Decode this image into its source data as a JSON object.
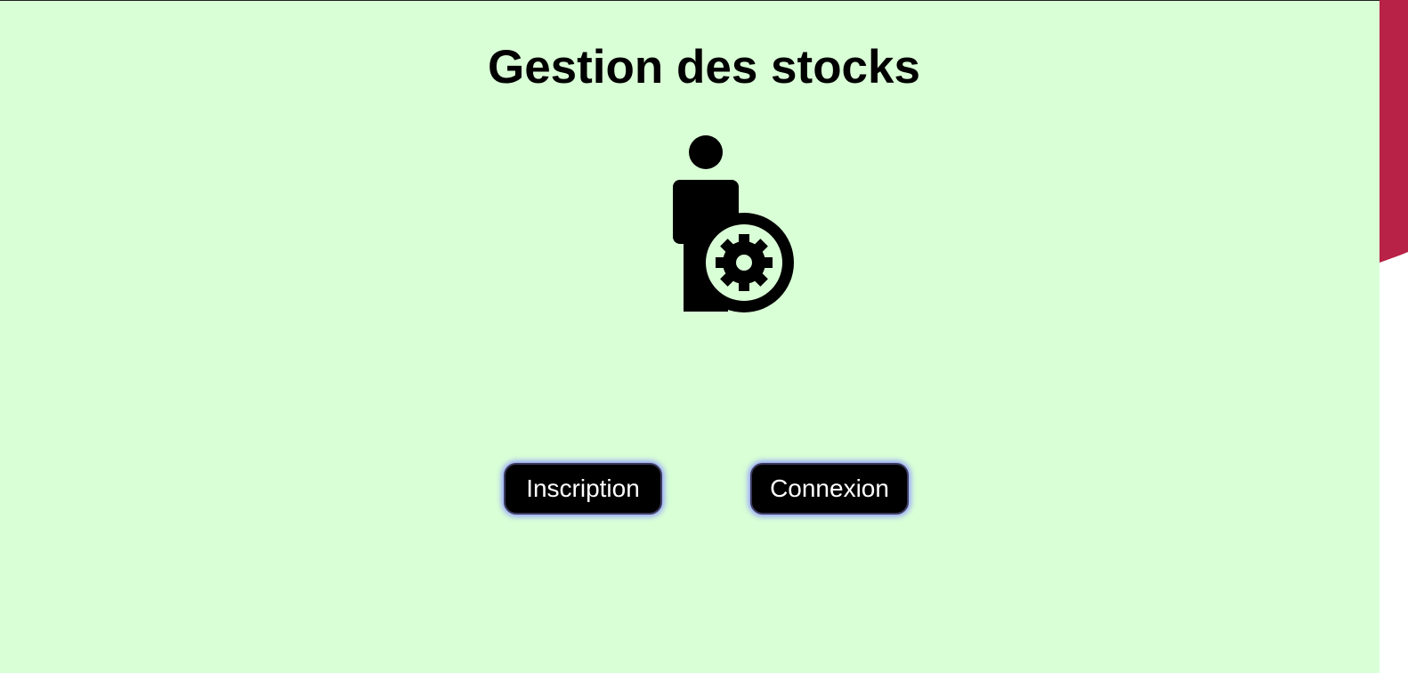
{
  "page": {
    "title": "Gestion des stocks",
    "background_color": "#d9ffd6",
    "accent_color": "#b82246"
  },
  "hero": {
    "icon": "user-gear-icon"
  },
  "actions": {
    "inscription_label": "Inscription",
    "connexion_label": "Connexion",
    "button_background": "#000000",
    "button_text_color": "#ffffff",
    "button_glow_color": "#8d95ff"
  }
}
